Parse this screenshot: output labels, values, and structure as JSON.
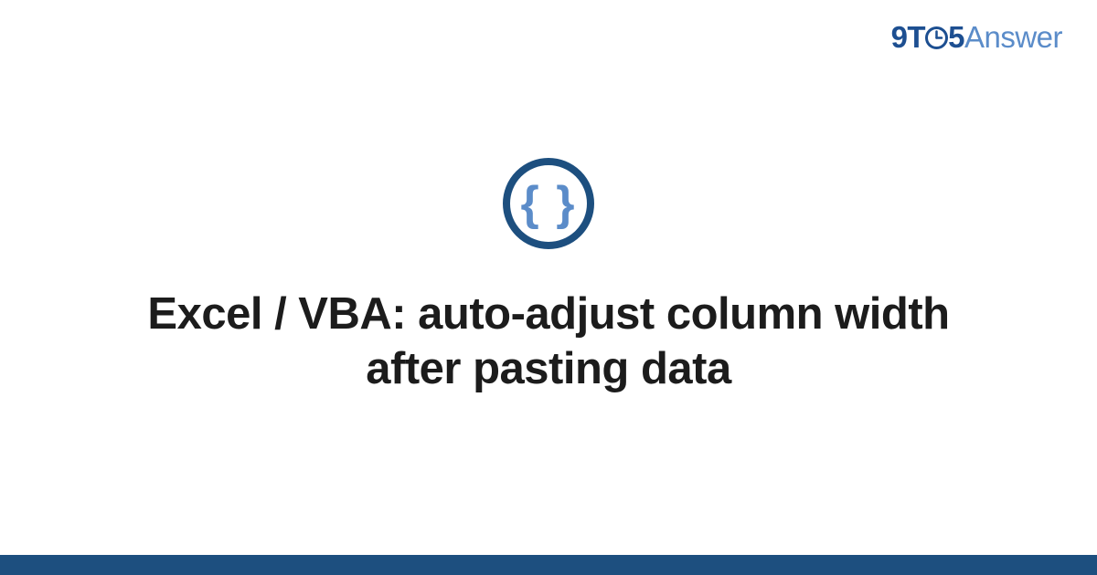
{
  "brand": {
    "nine": "9",
    "t": "T",
    "five": "5",
    "answer": "Answer"
  },
  "icon": {
    "glyph": "{ }"
  },
  "main": {
    "title": "Excel / VBA: auto-adjust column width after pasting data"
  },
  "colors": {
    "primary_dark": "#1d4f7f",
    "primary_blue": "#1d4f91",
    "accent_light": "#5b8cc9",
    "text": "#1c1c1c",
    "background": "#ffffff"
  }
}
